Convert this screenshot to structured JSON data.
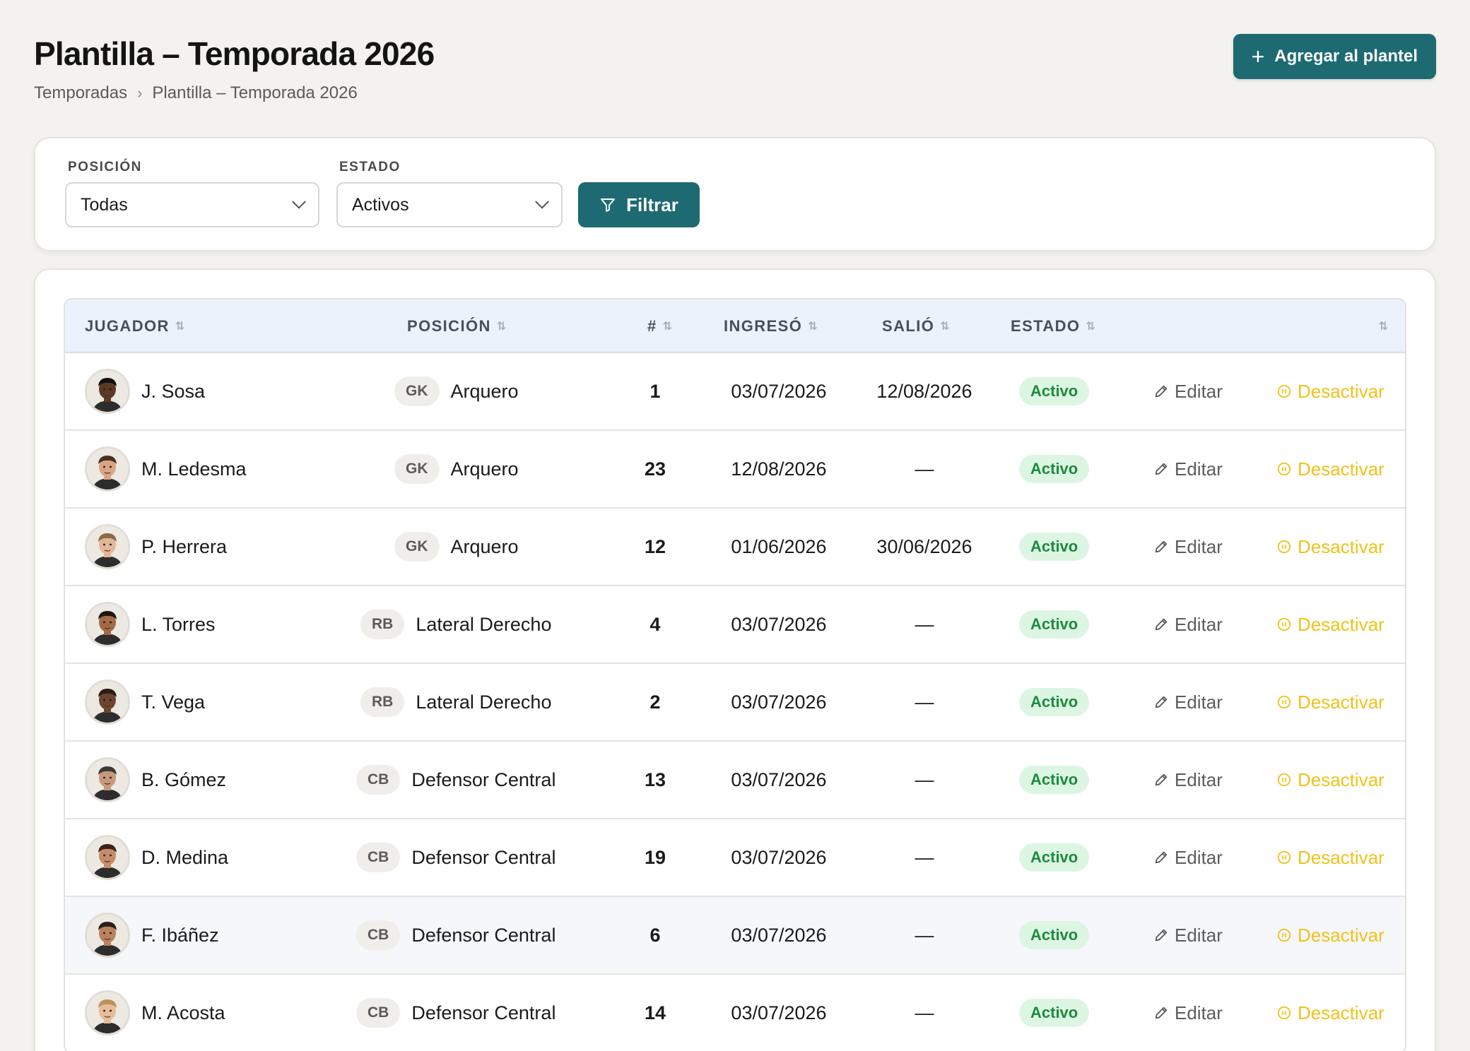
{
  "page": {
    "title": "Plantilla – Temporada 2026",
    "breadcrumb": {
      "root": "Temporadas",
      "separator": "›",
      "current": "Plantilla – Temporada 2026"
    },
    "add_button_label": "Agregar al plantel",
    "add_button_icon": "plus-icon"
  },
  "filters": {
    "position": {
      "label": "POSICIÓN",
      "value": "Todas"
    },
    "status": {
      "label": "ESTADO",
      "value": "Activos"
    },
    "filter_button_label": "Filtrar",
    "filter_button_icon": "funnel-icon"
  },
  "table": {
    "columns": {
      "player": "JUGADOR",
      "position": "POSICIÓN",
      "number": "#",
      "joined": "INGRESÓ",
      "left": "SALIÓ",
      "status": "ESTADO"
    },
    "sort_icon": "⇅",
    "actions": {
      "edit": "Editar",
      "deactivate": "Desactivar"
    },
    "rows": [
      {
        "player": "J. Sosa",
        "code": "GK",
        "position": "Arquero",
        "number": "1",
        "joined": "03/07/2026",
        "left": "12/08/2026",
        "status": "Activo",
        "skin": "#5b3a24",
        "hair": "#141010"
      },
      {
        "player": "M. Ledesma",
        "code": "GK",
        "position": "Arquero",
        "number": "23",
        "joined": "12/08/2026",
        "left": "—",
        "status": "Activo",
        "skin": "#d9a583",
        "hair": "#4a3020"
      },
      {
        "player": "P. Herrera",
        "code": "GK",
        "position": "Arquero",
        "number": "12",
        "joined": "01/06/2026",
        "left": "30/06/2026",
        "status": "Activo",
        "skin": "#e2b797",
        "hair": "#8a6a45"
      },
      {
        "player": "L. Torres",
        "code": "RB",
        "position": "Lateral Derecho",
        "number": "4",
        "joined": "03/07/2026",
        "left": "—",
        "status": "Activo",
        "skin": "#a36a44",
        "hair": "#1c1410"
      },
      {
        "player": "T. Vega",
        "code": "RB",
        "position": "Lateral Derecho",
        "number": "2",
        "joined": "03/07/2026",
        "left": "—",
        "status": "Activo",
        "skin": "#6e4630",
        "hair": "#2a1d16"
      },
      {
        "player": "B. Gómez",
        "code": "CB",
        "position": "Defensor Central",
        "number": "13",
        "joined": "03/07/2026",
        "left": "—",
        "status": "Activo",
        "skin": "#c8987a",
        "hair": "#3b3a3a"
      },
      {
        "player": "D. Medina",
        "code": "CB",
        "position": "Defensor Central",
        "number": "19",
        "joined": "03/07/2026",
        "left": "—",
        "status": "Activo",
        "skin": "#c78c69",
        "hair": "#3a2418"
      },
      {
        "player": "F. Ibáñez",
        "code": "CB",
        "position": "Defensor Central",
        "number": "6",
        "joined": "03/07/2026",
        "left": "—",
        "status": "Activo",
        "skin": "#b8825f",
        "hair": "#2c1e16"
      },
      {
        "player": "M. Acosta",
        "code": "CB",
        "position": "Defensor Central",
        "number": "14",
        "joined": "03/07/2026",
        "left": "—",
        "status": "Activo",
        "skin": "#e6bd98",
        "hair": "#b9915a"
      }
    ]
  },
  "colors": {
    "page_bg": "#f4f2ee",
    "primary": "#1d6a72",
    "status_active_bg": "#dcf6e3",
    "status_active_text": "#1f8a3e",
    "deactivate": "#f0c21b",
    "delete": "#e0453d",
    "header_bg": "#eaf2fc"
  }
}
